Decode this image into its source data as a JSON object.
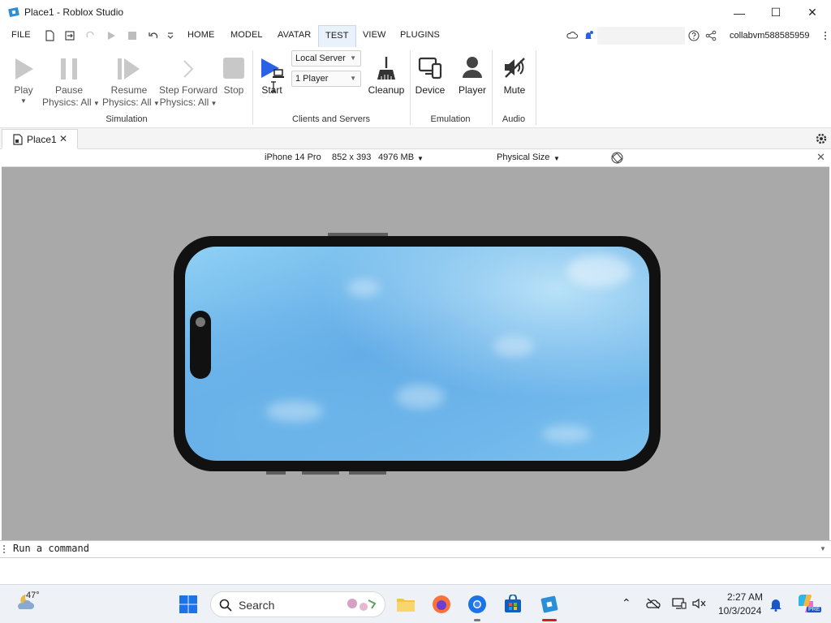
{
  "window": {
    "title": "Place1 - Roblox Studio",
    "minimize": "—",
    "maximize": "☐",
    "close": "✕"
  },
  "menu": {
    "file": "FILE",
    "home": "HOME",
    "model": "MODEL",
    "avatar": "AVATAR",
    "test": "TEST",
    "view": "VIEW",
    "plugins": "PLUGINS",
    "active_tab": "TEST",
    "username": "collabvm588585959"
  },
  "ribbon": {
    "simulation": {
      "group_label": "Simulation",
      "play": "Play",
      "pause": "Pause",
      "pause_sub": "Physics: All",
      "resume": "Resume",
      "resume_sub": "Physics: All",
      "step_forward": "Step Forward",
      "step_sub": "Physics: All",
      "stop": "Stop"
    },
    "clients": {
      "group_label": "Clients and Servers",
      "start": "Start",
      "server_mode": "Local Server",
      "players": "1 Player",
      "cleanup": "Cleanup"
    },
    "emulation": {
      "group_label": "Emulation",
      "device": "Device",
      "player": "Player"
    },
    "audio": {
      "group_label": "Audio",
      "mute": "Mute"
    }
  },
  "tabs": [
    {
      "label": "Place1",
      "close": "✕"
    }
  ],
  "emulation_bar": {
    "device_name": "iPhone 14 Pro",
    "resolution": "852 x 393",
    "memory": "4976 MB",
    "size_mode": "Physical Size",
    "close": "✕"
  },
  "command_bar": {
    "placeholder": "Run a command"
  },
  "taskbar": {
    "weather_temp": "47°",
    "search_label": "Search",
    "time": "2:27 AM",
    "date": "10/3/2024",
    "copilot_badge": "PRE"
  },
  "colors": {
    "accent_blue": "#2b61e6",
    "ribbon_active_bg": "#e9f1fb",
    "viewport_bg": "#a9a9a9",
    "phone_frame": "#111111",
    "sky_top": "#8fd0f4",
    "sky_mid": "#5fa9e6"
  }
}
